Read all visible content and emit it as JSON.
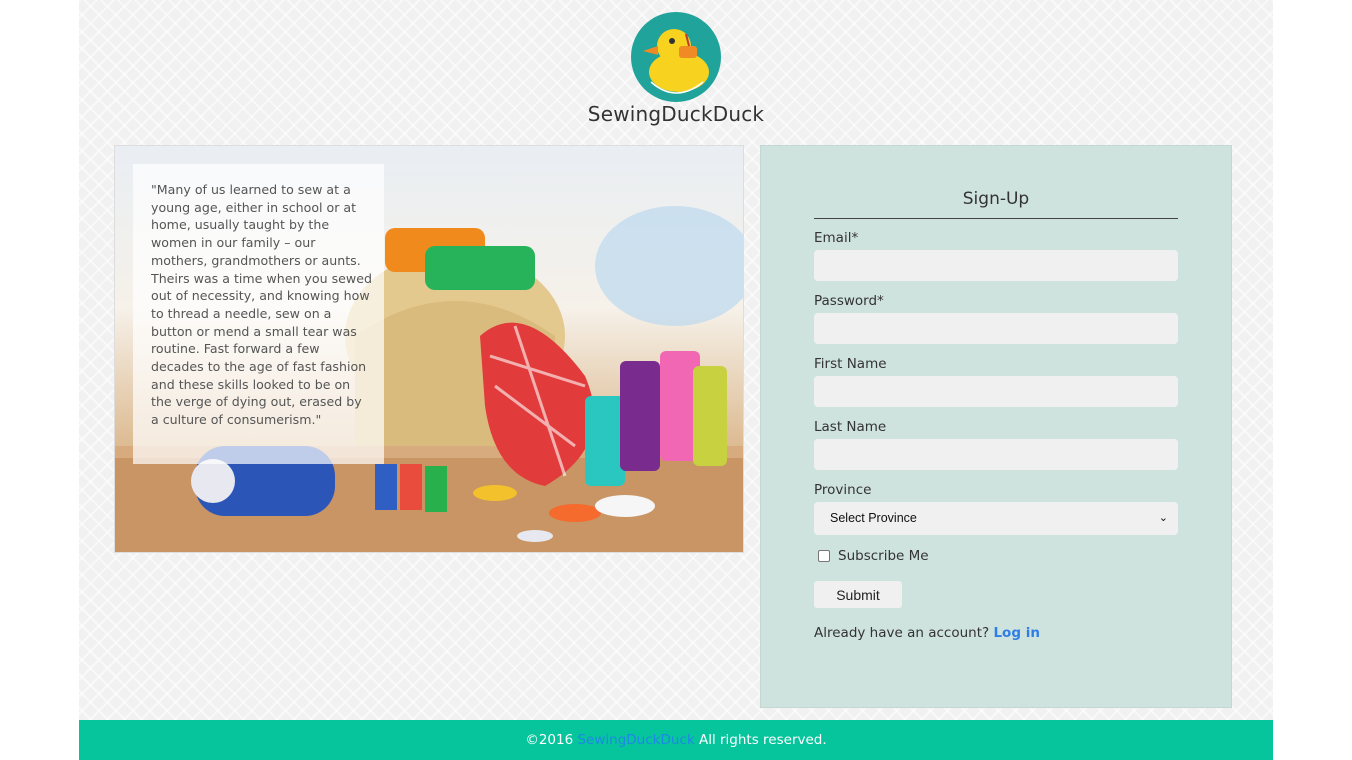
{
  "brand": {
    "site_name": "SewingDuckDuck",
    "logo_text": "SewingDuckDuck",
    "colors": {
      "teal": "#1fa39a",
      "duck_yellow": "#f7d21e",
      "footer": "#06c49c",
      "panel": "#cfe3de",
      "link": "#2f7ee6"
    }
  },
  "hero": {
    "quote": "\"Many of us learned to sew at a young age, either in school or at home, usually taught by the women in our family – our mothers, grandmothers or aunts. Theirs was a time when you sewed out of necessity, and knowing how to thread a needle, sew on a button or mend a small tear was routine. Fast forward a few decades to the age of fast fashion and these skills looked to be on the verge of dying out, erased by a culture of consumerism.\""
  },
  "signup": {
    "title": "Sign-Up",
    "email_label": "Email*",
    "email_value": "",
    "password_label": "Password*",
    "password_value": "",
    "first_name_label": "First Name",
    "first_name_value": "",
    "last_name_label": "Last Name",
    "last_name_value": "",
    "province_label": "Province",
    "province_selected": "Select Province",
    "subscribe_label": "Subscribe Me",
    "subscribe_checked": false,
    "submit_label": "Submit",
    "login_prompt": "Already have an account?",
    "login_link": "Log in"
  },
  "footer": {
    "copyright": "©2016",
    "site_link": "SewingDuckDuck",
    "rights": "All rights reserved."
  }
}
